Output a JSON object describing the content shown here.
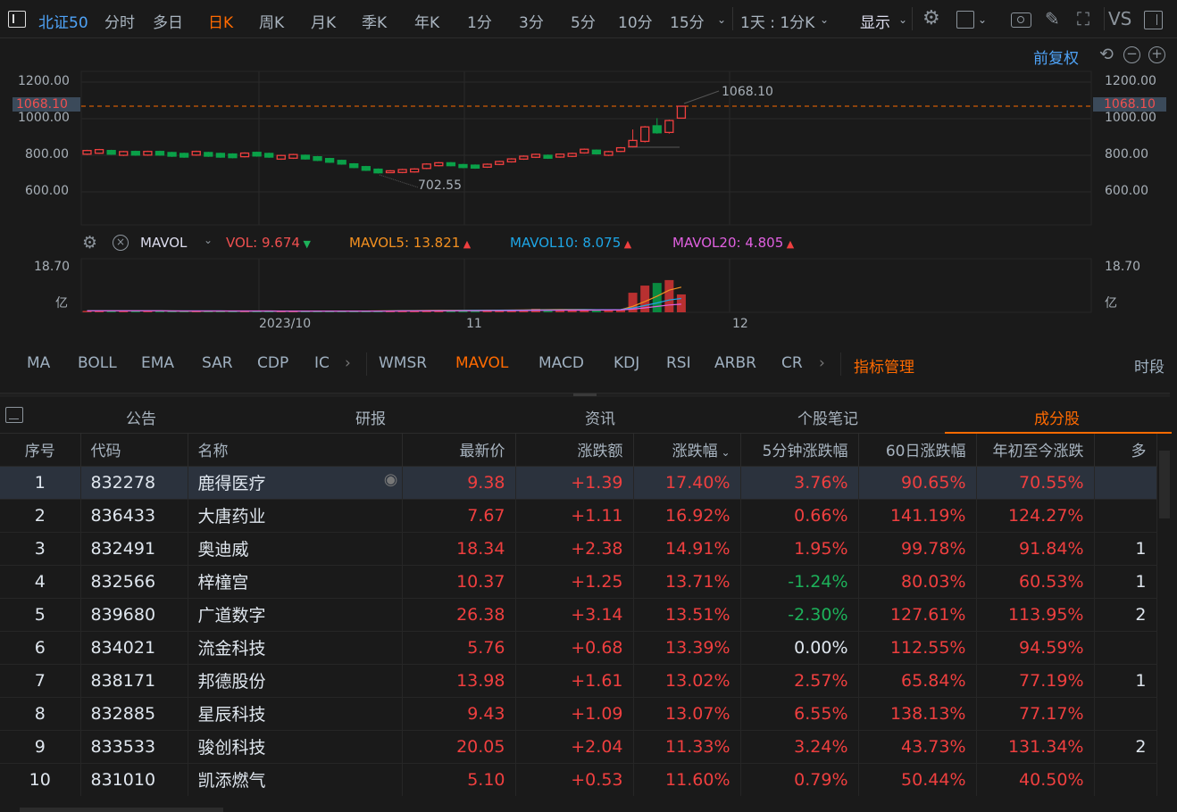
{
  "toolbar": {
    "symbol": "北证50",
    "periods": [
      "分时",
      "多日",
      "日K",
      "周K",
      "月K",
      "季K",
      "年K",
      "1分",
      "3分",
      "5分",
      "10分",
      "15分"
    ],
    "active_period": "日K",
    "range_select": "1天 : 1分K",
    "display_label": "显示",
    "vs_label": "VS"
  },
  "chart_controls": {
    "adjust_label": "前复权"
  },
  "price_axis": {
    "ticks": [
      "1200.00",
      "1000.00",
      "800.00",
      "600.00"
    ],
    "current": "1068.10"
  },
  "annotations": {
    "high": "1068.10",
    "low": "702.55"
  },
  "indicator": {
    "name": "MAVOL",
    "vol_label": "VOL:",
    "vol_value": "9.674",
    "mavol5_label": "MAVOL5:",
    "mavol5_value": "13.821",
    "mavol10_label": "MAVOL10:",
    "mavol10_value": "8.075",
    "mavol20_label": "MAVOL20:",
    "mavol20_value": "4.805",
    "axis_max": "18.70",
    "axis_unit": "亿"
  },
  "x_axis": {
    "labels": [
      "2023/10",
      "11",
      "12"
    ]
  },
  "indicator_tabs": [
    "MA",
    "BOLL",
    "EMA",
    "SAR",
    "CDP",
    "IC",
    "WMSR",
    "MAVOL",
    "MACD",
    "KDJ",
    "RSI",
    "ARBR",
    "CR"
  ],
  "indicator_manage": "指标管理",
  "period_label": "时段",
  "colors": {
    "up": "#ef3f3f",
    "down": "#0aa048",
    "accent": "#ff6a00",
    "link": "#4fa3f7"
  },
  "chart_data": {
    "type": "candlestick",
    "ylim": [
      600,
      1200
    ],
    "candles": [
      [
        806,
        830,
        802,
        826
      ],
      [
        811,
        835,
        807,
        831
      ],
      [
        826,
        830,
        802,
        806
      ],
      [
        800,
        824,
        796,
        820
      ],
      [
        821,
        825,
        797,
        801
      ],
      [
        801,
        825,
        797,
        821
      ],
      [
        821,
        825,
        797,
        801
      ],
      [
        815,
        819,
        791,
        795
      ],
      [
        810,
        814,
        786,
        790
      ],
      [
        801,
        825,
        797,
        821
      ],
      [
        815,
        819,
        791,
        795
      ],
      [
        810,
        814,
        786,
        790
      ],
      [
        807,
        811,
        783,
        787
      ],
      [
        792,
        816,
        788,
        812
      ],
      [
        816,
        820,
        792,
        796
      ],
      [
        810,
        814,
        786,
        790
      ],
      [
        779,
        803,
        775,
        799
      ],
      [
        784,
        808,
        780,
        804
      ],
      [
        800,
        804,
        776,
        780
      ],
      [
        792,
        796,
        768,
        772
      ],
      [
        782,
        786,
        758,
        762
      ],
      [
        772,
        776,
        748,
        752
      ],
      [
        753,
        757,
        729,
        733
      ],
      [
        738,
        742,
        714,
        718
      ],
      [
        724,
        728,
        700,
        704
      ],
      [
        705,
        719,
        702.55,
        715
      ],
      [
        706,
        726,
        702,
        722
      ],
      [
        709,
        729,
        705,
        725
      ],
      [
        728,
        756,
        724,
        752
      ],
      [
        743,
        763,
        739,
        759
      ],
      [
        759,
        763,
        739,
        743
      ],
      [
        749,
        753,
        729,
        733
      ],
      [
        746,
        750,
        726,
        730
      ],
      [
        735,
        755,
        731,
        751
      ],
      [
        750,
        770,
        746,
        766
      ],
      [
        764,
        784,
        760,
        780
      ],
      [
        779,
        799,
        775,
        795
      ],
      [
        789,
        809,
        785,
        805
      ],
      [
        800,
        804,
        780,
        784
      ],
      [
        790,
        810,
        786,
        806
      ],
      [
        794,
        814,
        790,
        810
      ],
      [
        813,
        837,
        809,
        833
      ],
      [
        828,
        832,
        804,
        808
      ],
      [
        800,
        824,
        796,
        820
      ],
      [
        821,
        845,
        817,
        841
      ],
      [
        847,
        941,
        843,
        881
      ],
      [
        876,
        960,
        870,
        955
      ],
      [
        961,
        1003,
        918,
        923
      ],
      [
        925,
        995,
        918,
        990
      ],
      [
        1003,
        1068.1,
        1000,
        1068.1
      ]
    ],
    "volume": [
      0.6,
      0.6,
      0.6,
      0.6,
      0.6,
      0.5,
      0.6,
      0.5,
      0.5,
      0.6,
      0.5,
      0.5,
      0.5,
      0.5,
      0.5,
      0.5,
      0.5,
      0.5,
      0.5,
      0.5,
      0.5,
      0.5,
      0.6,
      0.6,
      0.6,
      0.7,
      0.8,
      0.8,
      0.9,
      0.9,
      0.8,
      0.8,
      0.8,
      1.0,
      1.0,
      1.0,
      1.0,
      1.5,
      1.2,
      1.1,
      1.0,
      1.1,
      1.1,
      1.0,
      1.2,
      8.2,
      11.2,
      12.3,
      13.5,
      7.5
    ],
    "vol_max": 18.7
  },
  "panel_tabs": [
    "公告",
    "研报",
    "资讯",
    "个股笔记",
    "成分股"
  ],
  "active_panel_tab": "成分股",
  "table": {
    "headers": [
      "序号",
      "代码",
      "名称",
      "最新价",
      "涨跌额",
      "涨跌幅",
      "5分钟涨跌幅",
      "60日涨跌幅",
      "年初至今涨跌",
      "多"
    ],
    "rows": [
      [
        "1",
        "832278",
        "鹿得医疗",
        "9.38",
        "+1.39",
        "17.40%",
        "3.76%",
        "90.65%",
        "70.55%",
        ""
      ],
      [
        "2",
        "836433",
        "大唐药业",
        "7.67",
        "+1.11",
        "16.92%",
        "0.66%",
        "141.19%",
        "124.27%",
        ""
      ],
      [
        "3",
        "832491",
        "奥迪威",
        "18.34",
        "+2.38",
        "14.91%",
        "1.95%",
        "99.78%",
        "91.84%",
        "1"
      ],
      [
        "4",
        "832566",
        "梓橦宫",
        "10.37",
        "+1.25",
        "13.71%",
        "-1.24%",
        "80.03%",
        "60.53%",
        "1"
      ],
      [
        "5",
        "839680",
        "广道数字",
        "26.38",
        "+3.14",
        "13.51%",
        "-2.30%",
        "127.61%",
        "113.95%",
        "2"
      ],
      [
        "6",
        "834021",
        "流金科技",
        "5.76",
        "+0.68",
        "13.39%",
        "0.00%",
        "112.55%",
        "94.59%",
        ""
      ],
      [
        "7",
        "838171",
        "邦德股份",
        "13.98",
        "+1.61",
        "13.02%",
        "2.57%",
        "65.84%",
        "77.19%",
        "1"
      ],
      [
        "8",
        "832885",
        "星辰科技",
        "9.43",
        "+1.09",
        "13.07%",
        "6.55%",
        "138.13%",
        "77.17%",
        ""
      ],
      [
        "9",
        "833533",
        "骏创科技",
        "20.05",
        "+2.04",
        "11.33%",
        "3.24%",
        "43.73%",
        "131.34%",
        "2"
      ],
      [
        "10",
        "831010",
        "凯添燃气",
        "5.10",
        "+0.53",
        "11.60%",
        "0.79%",
        "50.44%",
        "40.50%",
        ""
      ]
    ]
  }
}
